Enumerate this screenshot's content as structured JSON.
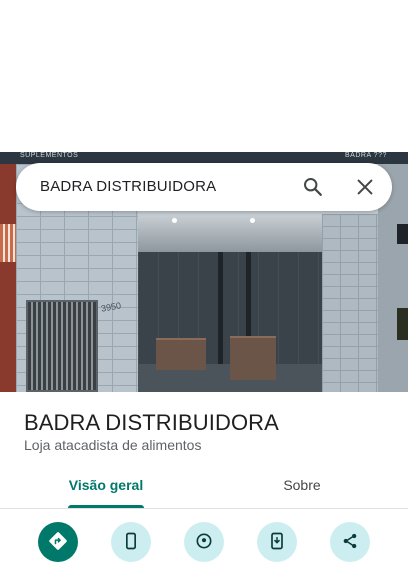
{
  "search": {
    "query": "BADRA DISTRIBUIDORA"
  },
  "photo": {
    "sign_left": "SUPLEMENTOS",
    "sign_right": "BADRA ???",
    "door_number": "3950"
  },
  "place": {
    "name": "BADRA DISTRIBUIDORA",
    "category": "Loja atacadista de alimentos"
  },
  "tabs": [
    {
      "label": "Visão geral",
      "selected": true
    },
    {
      "label": "Sobre",
      "selected": false
    }
  ],
  "actions": [
    {
      "icon": "directions-icon"
    },
    {
      "icon": "phone-icon"
    },
    {
      "icon": "location-pin-icon"
    },
    {
      "icon": "save-to-phone-icon"
    },
    {
      "icon": "share-icon"
    }
  ],
  "colors": {
    "accent": "#00796b",
    "action_secondary_bg": "#cdeef0",
    "title_text": "#1f1f1f",
    "secondary_text": "#5f6368"
  }
}
